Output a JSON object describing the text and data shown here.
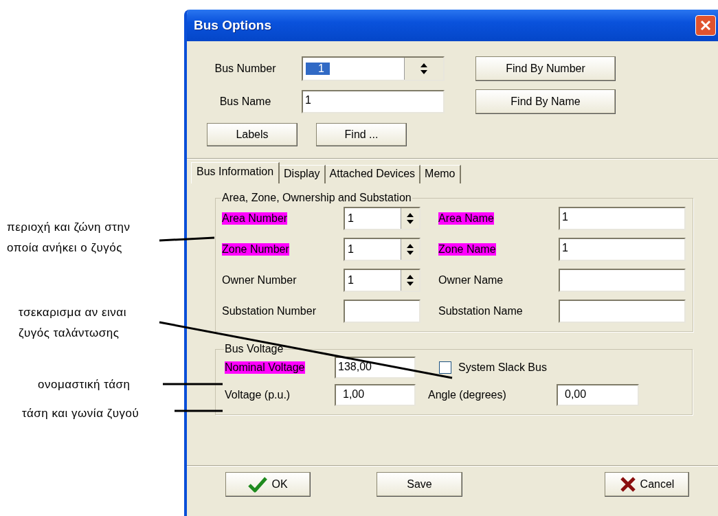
{
  "window": {
    "title": "Bus Options"
  },
  "bus_number": {
    "label": "Bus Number",
    "value": "1",
    "value_selected": true
  },
  "bus_name": {
    "label": "Bus Name",
    "value": "1"
  },
  "side_buttons": [
    "Find By Number",
    "Find By Name"
  ],
  "lower_buttons": [
    "Labels",
    "Find ..."
  ],
  "tabs": [
    {
      "label": "Bus Information",
      "selected": true
    },
    {
      "label": "Display",
      "selected": false
    },
    {
      "label": "Attached Devices",
      "selected": false
    },
    {
      "label": "Memo",
      "selected": false
    }
  ],
  "area_group": {
    "title": "Area, Zone, Ownership and Substation",
    "rows": [
      {
        "number": {
          "label": "Area Number",
          "highlighted": true,
          "kind": "spin",
          "value": "1"
        },
        "name": {
          "label": "Area Name",
          "highlighted": true,
          "value": "1"
        }
      },
      {
        "number": {
          "label": "Zone Number",
          "highlighted": true,
          "kind": "spin",
          "value": "1"
        },
        "name": {
          "label": "Zone Name",
          "highlighted": true,
          "value": "1"
        }
      },
      {
        "number": {
          "label": "Owner Number",
          "highlighted": false,
          "kind": "spin",
          "value": "1"
        },
        "name": {
          "label": "Owner Name",
          "highlighted": false
        }
      },
      {
        "number": {
          "label": "Substation Number",
          "highlighted": false,
          "kind": "text"
        },
        "name": {
          "label": "Substation Name",
          "highlighted": false
        }
      }
    ]
  },
  "voltage_group": {
    "title": "Bus Voltage",
    "nominal": {
      "label": "Nominal Voltage",
      "highlighted": true,
      "value": "138,00"
    },
    "slack": {
      "label": "System Slack Bus",
      "checked": false
    },
    "voltage": {
      "label": "Voltage (p.u.)",
      "highlighted": false,
      "value": "1,00"
    },
    "angle": {
      "label": "Angle (degrees)",
      "value": "0,00"
    }
  },
  "footer_buttons": [
    {
      "label": "OK",
      "kind": "ok"
    },
    {
      "label": "Save",
      "kind": "plain"
    },
    {
      "label": "Cancel",
      "kind": "cancel"
    }
  ],
  "annotations": [
    {
      "lines": [
        "περιοχή και ζώνη στην",
        "οποία ανήκει ο ζυγός"
      ]
    },
    {
      "lines": [
        "τσεκαρισμα αν ειναι",
        "ζυγός ταλάντωσης"
      ]
    },
    {
      "lines": [
        "ονομαστική τάση"
      ]
    },
    {
      "lines": [
        "τάση και γωνία ζυγού"
      ]
    }
  ]
}
